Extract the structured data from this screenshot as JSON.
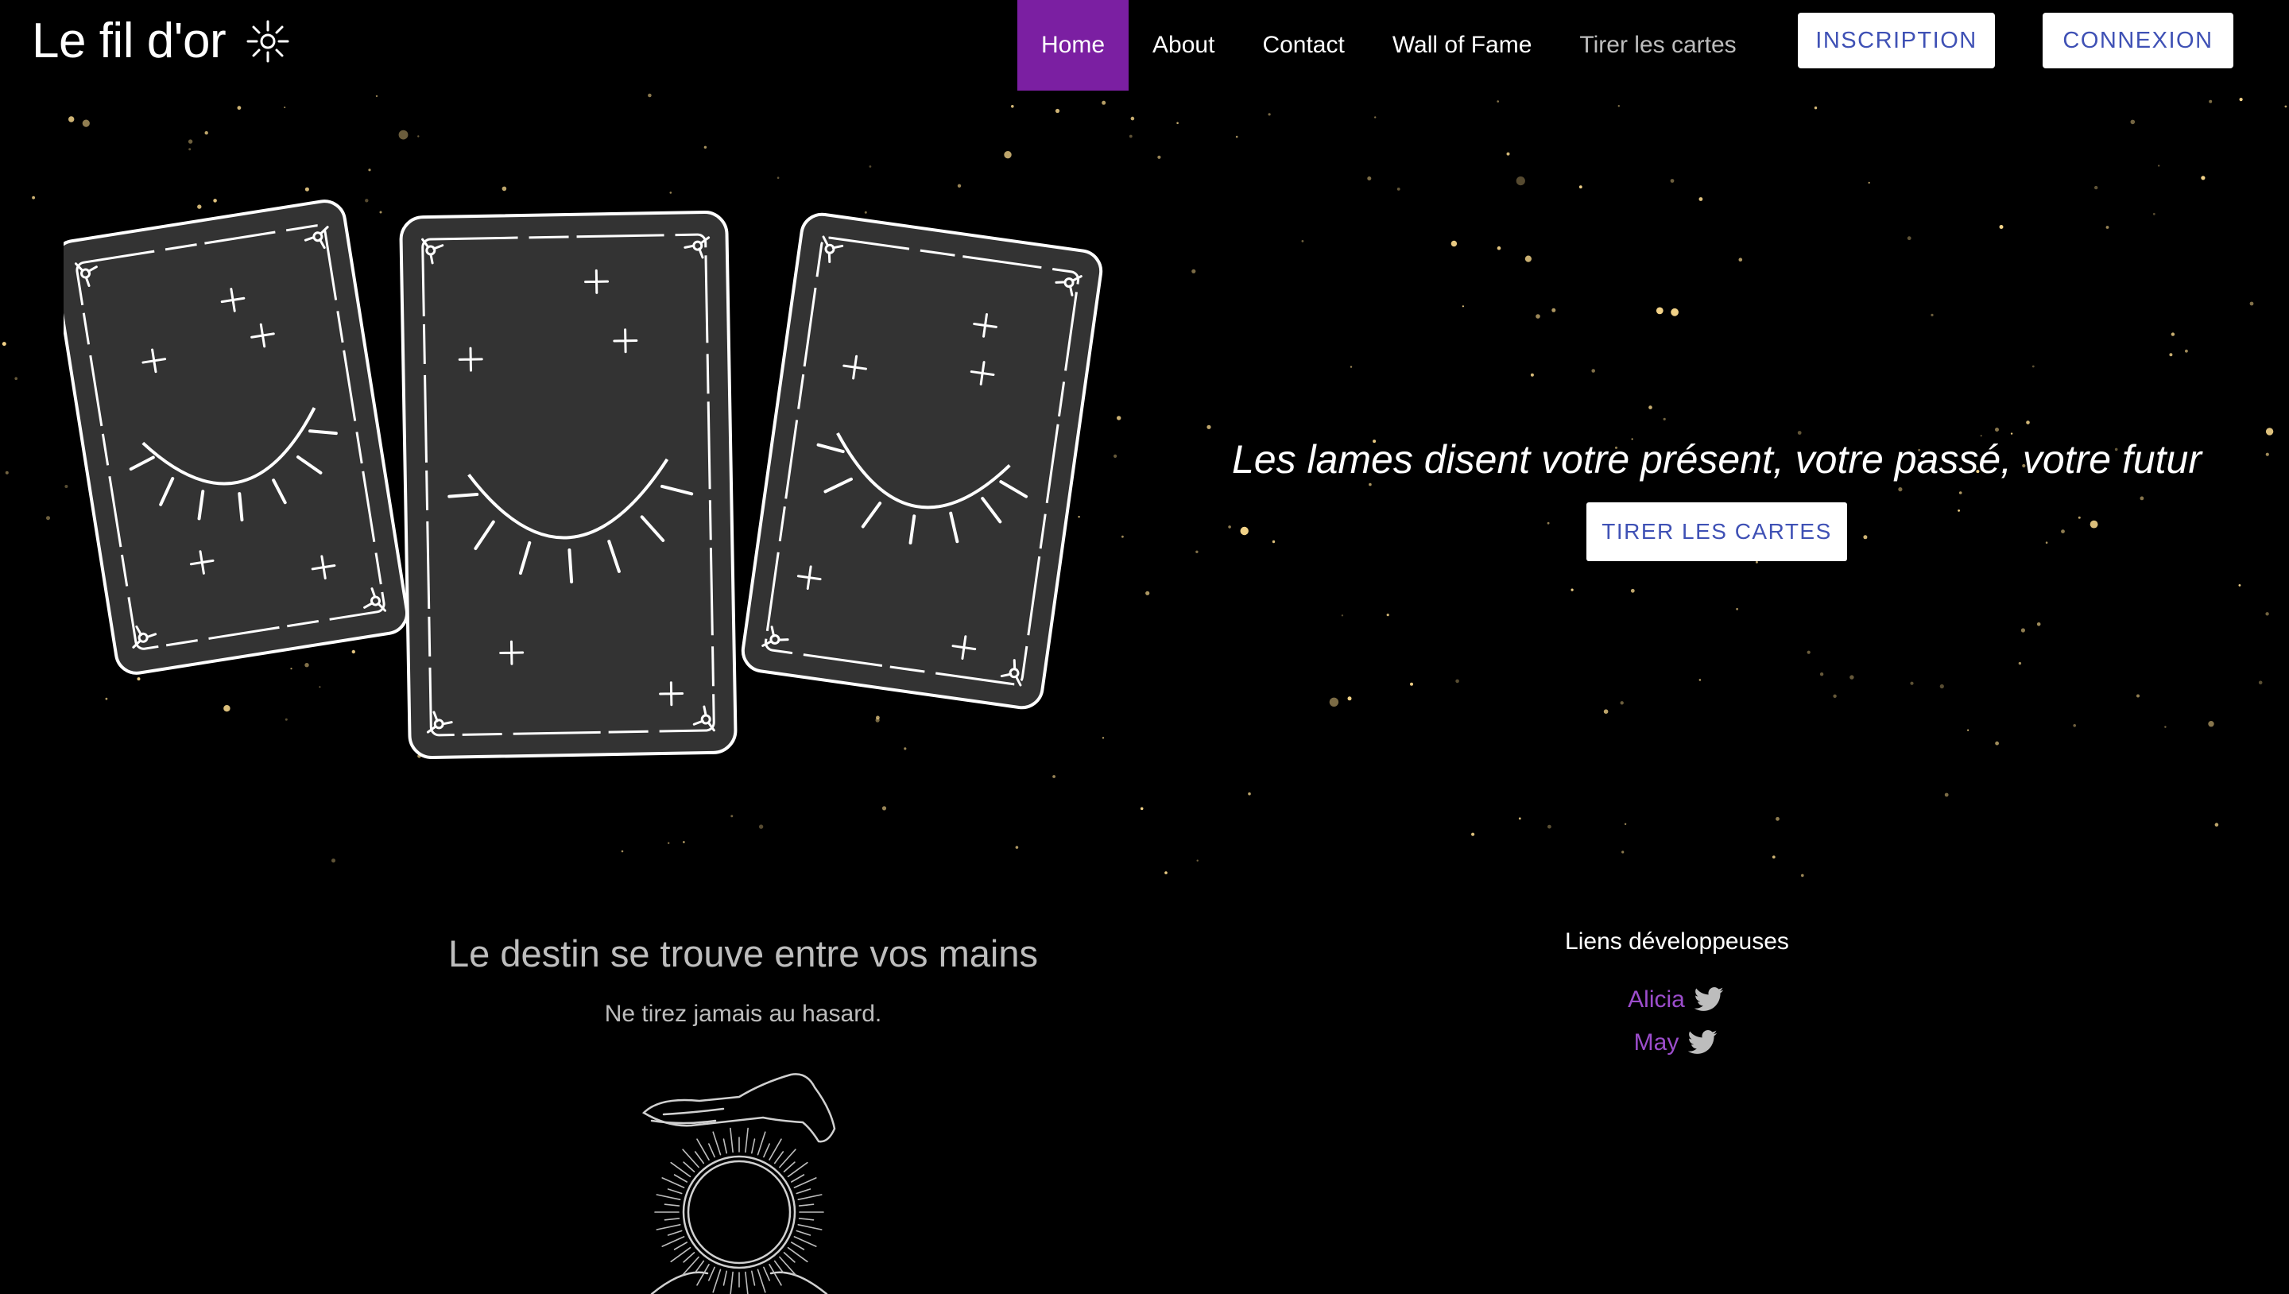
{
  "brand": {
    "name": "Le fil d'or",
    "icon": "sun-sparkle-icon"
  },
  "nav": {
    "items": [
      {
        "label": "Home",
        "active": true
      },
      {
        "label": "About"
      },
      {
        "label": "Contact"
      },
      {
        "label": "Wall of Fame"
      },
      {
        "label": "Tirer les cartes",
        "muted": true
      }
    ],
    "inscription_label": "INSCRIPTION",
    "connexion_label": "CONNEXION"
  },
  "hero": {
    "tagline": "Les lames disent votre présent, votre passé, votre futur",
    "cta_label": "TIRER LES CARTES"
  },
  "footer": {
    "headline": "Le destin se trouve entre vos mains",
    "subtext": "Ne tirez jamais au hasard.",
    "links_title": "Liens développeuses",
    "dev_links": [
      {
        "name": "Alicia",
        "icon": "twitter-icon"
      },
      {
        "name": "May",
        "icon": "twitter-icon"
      }
    ]
  },
  "colors": {
    "background": "#000000",
    "accent": "#7b1fa2",
    "link": "#9c4dcc",
    "button_text": "#3f51b5",
    "card_fill": "#333333",
    "star": "#f5d58a"
  }
}
